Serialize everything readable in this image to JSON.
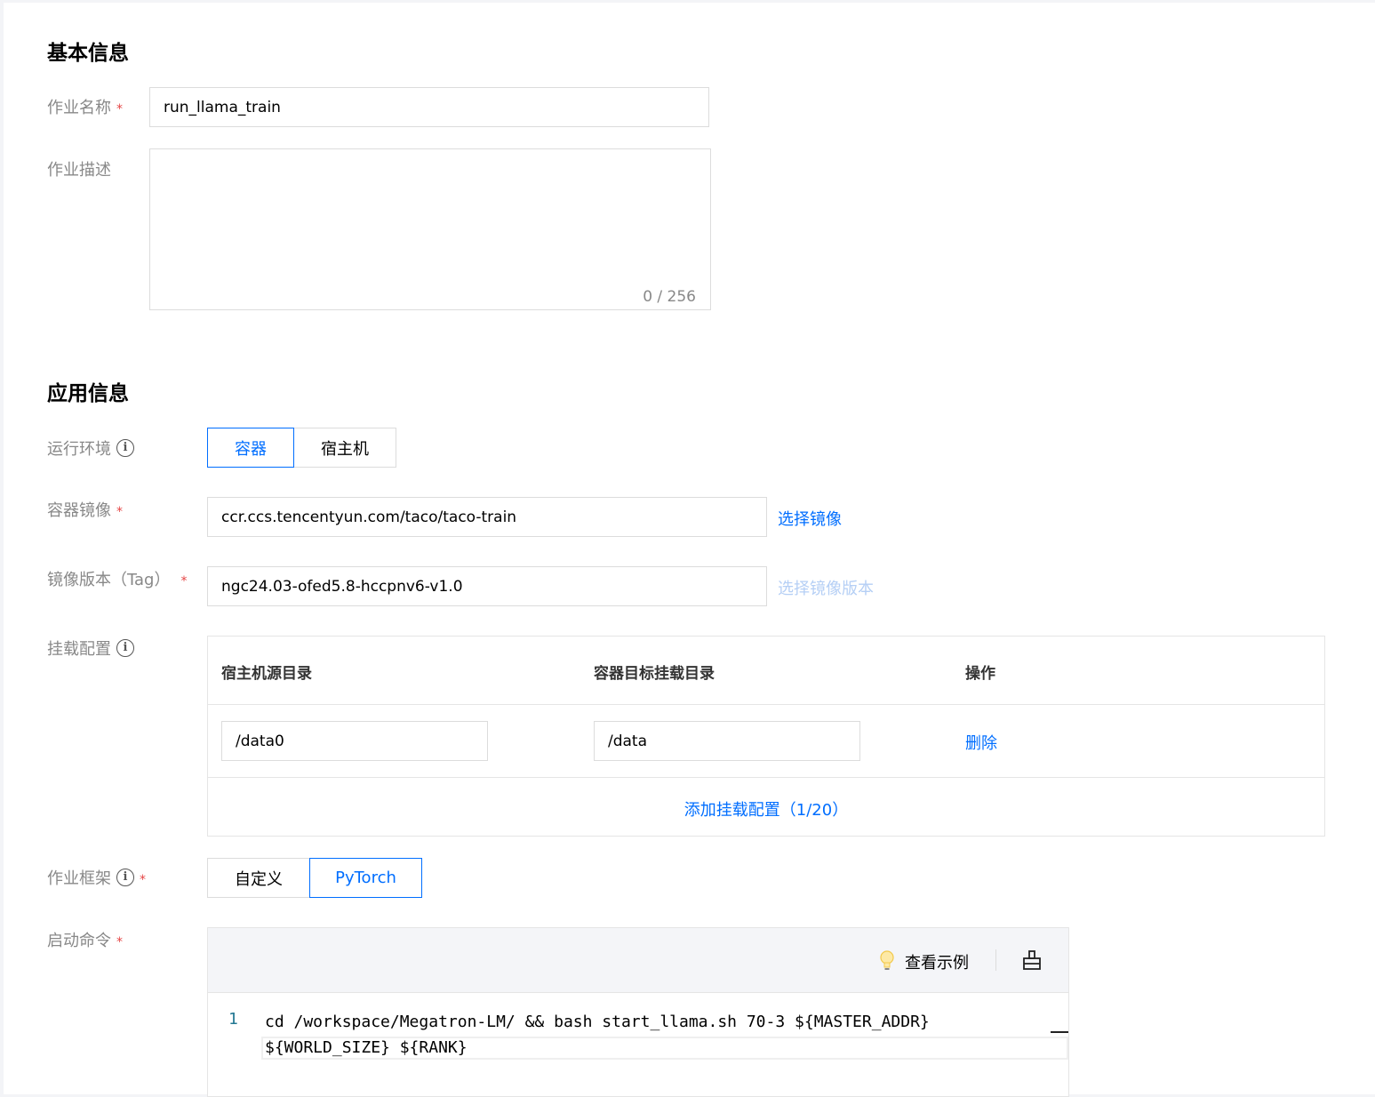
{
  "basic": {
    "title": "基本信息",
    "job_name_label": "作业名称",
    "job_name_value": "run_llama_train",
    "job_desc_label": "作业描述",
    "job_desc_value": "",
    "job_desc_counter": "0 / 256",
    "required_mark": "*"
  },
  "app": {
    "title": "应用信息",
    "env_label": "运行环境",
    "env_options": [
      "容器",
      "宿主机"
    ],
    "env_selected": "容器",
    "image_label": "容器镜像",
    "image_value": "ccr.ccs.tencentyun.com/taco/taco-train",
    "image_select_link": "选择镜像",
    "tag_label": "镜像版本（Tag）",
    "tag_value": "ngc24.03-ofed5.8-hccpnv6-v1.0",
    "tag_select_link": "选择镜像版本",
    "mount_label": "挂载配置",
    "mount_table": {
      "headers": [
        "宿主机源目录",
        "容器目标挂载目录",
        "操作"
      ],
      "rows": [
        {
          "source": "/data0",
          "target": "/data",
          "action": "删除"
        }
      ],
      "add_link": "添加挂载配置（1/20）"
    },
    "framework_label": "作业框架",
    "framework_options": [
      "自定义",
      "PyTorch"
    ],
    "framework_selected": "PyTorch",
    "cmd_label": "启动命令",
    "cmd_example": "查看示例",
    "cmd_lines": [
      {
        "no": "1",
        "text": "cd /workspace/Megatron-LM/ && bash start_llama.sh 70-3 ${MASTER_ADDR} ${WORLD_SIZE} ${RANK}"
      }
    ]
  },
  "icons": {
    "info": "info-icon",
    "bulb": "lightbulb-icon",
    "format": "format-icon"
  },
  "colors": {
    "accent": "#006eff",
    "required": "#e54545",
    "label": "#888888",
    "disabled_link": "#b5cff5"
  }
}
